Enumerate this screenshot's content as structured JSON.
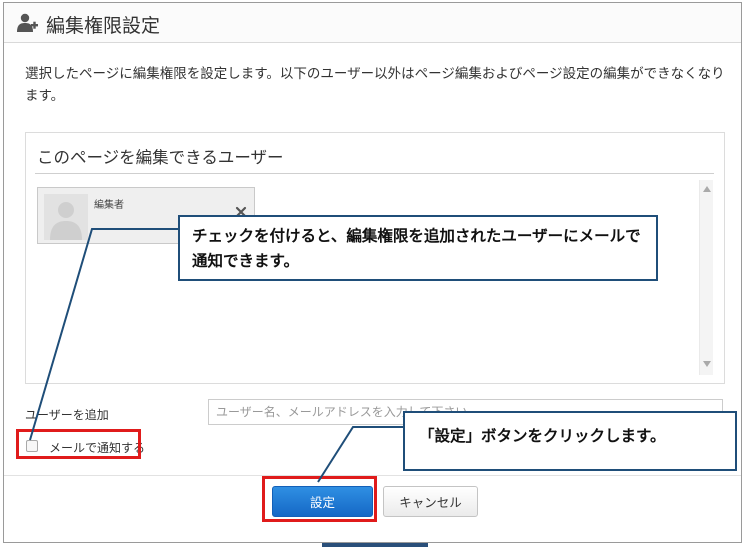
{
  "dialog": {
    "title": "編集権限設定",
    "icon": "user-add-icon",
    "description": "選択したページに編集権限を設定します。以下のユーザー以外はページ編集およびページ設定の編集ができなくなります。"
  },
  "users_panel": {
    "title": "このページを編集できるユーザー",
    "users": [
      {
        "name": "編集者",
        "avatar_icon": "avatar-placeholder-icon",
        "remove_icon": "close-icon"
      }
    ]
  },
  "add_user": {
    "label": "ユーザーを追加",
    "placeholder": "ユーザー名、メールアドレスを入力して下さい",
    "value": ""
  },
  "notify": {
    "label": "メールで通知する",
    "checked": false
  },
  "buttons": {
    "primary": "設定",
    "secondary": "キャンセル"
  },
  "annotations": {
    "notify_callout": "チェックを付けると、編集権限を追加されたユーザーにメールで通知できます。",
    "button_callout": "「設定」ボタンをクリックします。",
    "highlight_color": "#e01b1b",
    "callout_border_color": "#1f4e79"
  }
}
